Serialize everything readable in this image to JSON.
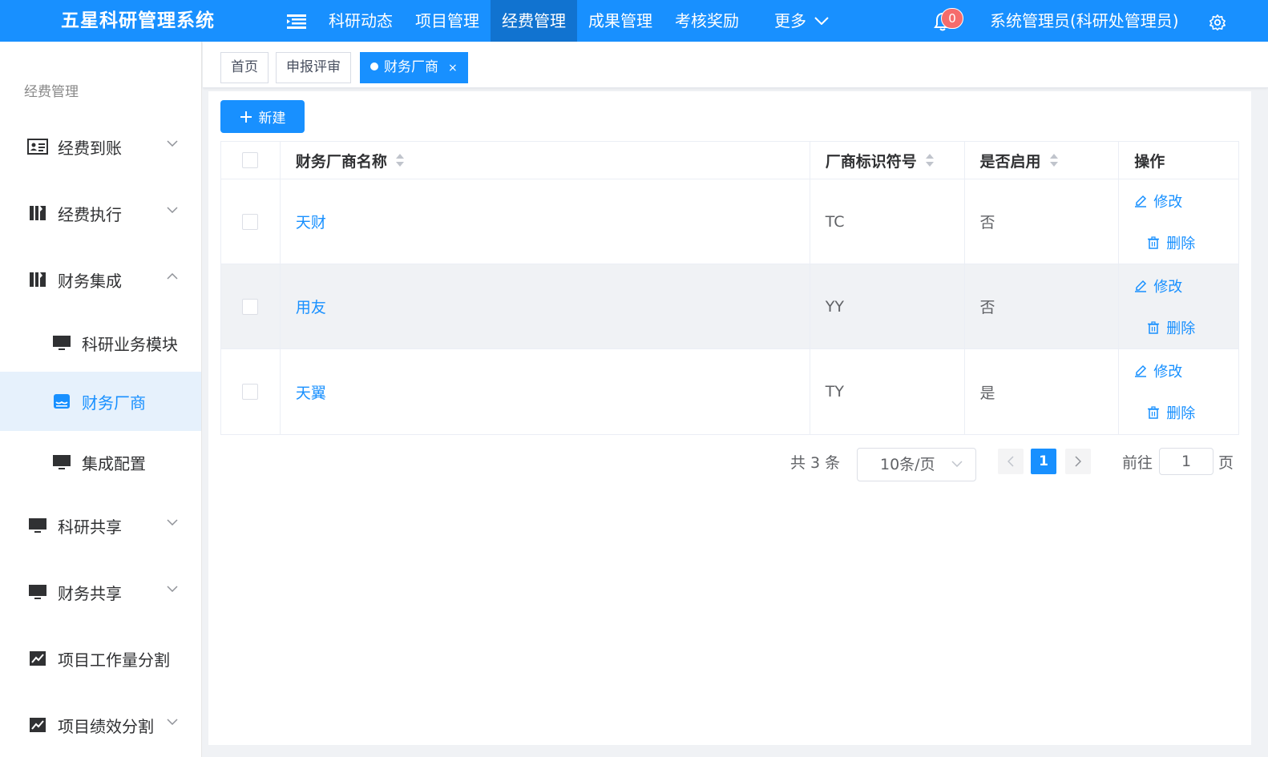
{
  "header": {
    "title": "五星科研管理系统",
    "nav": [
      "科研动态",
      "项目管理",
      "经费管理",
      "成果管理",
      "考核奖励"
    ],
    "active_nav": "经费管理",
    "more_label": "更多",
    "notification_count": "0",
    "user": "系统管理员(科研处管理员)"
  },
  "sidebar": {
    "group_title": "经费管理",
    "items": [
      {
        "label": "经费到账"
      },
      {
        "label": "经费执行"
      },
      {
        "label": "财务集成"
      },
      {
        "label": "科研业务模块"
      },
      {
        "label": "财务厂商"
      },
      {
        "label": "集成配置"
      },
      {
        "label": "科研共享"
      },
      {
        "label": "财务共享"
      },
      {
        "label": "项目工作量分割"
      },
      {
        "label": "项目绩效分割"
      }
    ]
  },
  "tabs": [
    {
      "label": "首页"
    },
    {
      "label": "申报评审"
    },
    {
      "label": "财务厂商",
      "close": "×"
    }
  ],
  "toolbar": {
    "new_label": "新建"
  },
  "table": {
    "columns": [
      "财务厂商名称",
      "厂商标识符号",
      "是否启用",
      "操作"
    ],
    "rows": [
      {
        "name": "天财",
        "code": "TC",
        "enabled": "否"
      },
      {
        "name": "用友",
        "code": "YY",
        "enabled": "否"
      },
      {
        "name": "天翼",
        "code": "TY",
        "enabled": "是"
      }
    ],
    "edit_label": "修改",
    "delete_label": "删除"
  },
  "pagination": {
    "total_text": "共 3 条",
    "page_size": "10条/页",
    "current_page": "1",
    "goto_label": "前往",
    "goto_value": "1",
    "page_suffix": "页"
  },
  "colors": {
    "primary": "#1890ff",
    "header_active": "#1173d0",
    "badge": "#f56c6c"
  }
}
